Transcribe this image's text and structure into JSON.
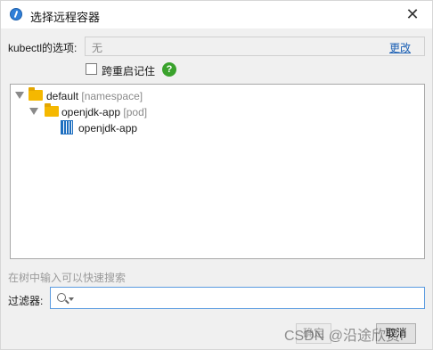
{
  "window": {
    "title": "选择远程容器",
    "close_icon": "close-icon"
  },
  "options": {
    "label": "kubectl的选项:",
    "value": "无",
    "change_link": "更改"
  },
  "remember": {
    "label": "跨重启记住",
    "checked": false,
    "help_glyph": "?"
  },
  "tree": {
    "nodes": [
      {
        "name": "default",
        "type": "[namespace]",
        "icon": "folder-icon",
        "expanded": true
      },
      {
        "name": "openjdk-app",
        "type": "[pod]",
        "icon": "folder-icon",
        "expanded": true
      },
      {
        "name": "openjdk-app",
        "type": "",
        "icon": "container-icon"
      }
    ]
  },
  "filter": {
    "hint": "在树中输入可以快速搜索",
    "label": "过滤器:",
    "value": ""
  },
  "buttons": {
    "ok": "确定",
    "cancel": "取消"
  },
  "watermark": "CSDN @沿途欣赏i"
}
